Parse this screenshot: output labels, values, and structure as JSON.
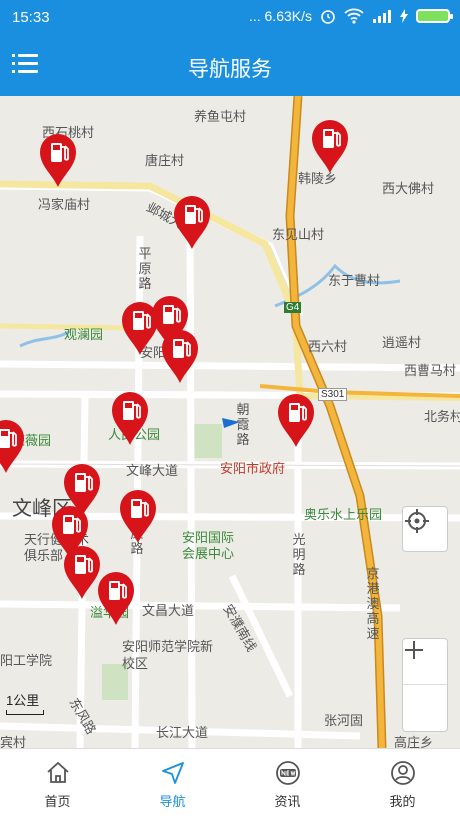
{
  "status": {
    "time": "15:33",
    "speed": "... 6.63K/s"
  },
  "header": {
    "title": "导航服务"
  },
  "map": {
    "labels": [
      {
        "id": "yangyutun",
        "text": "养鱼屯村"
      },
      {
        "id": "xishitaocun",
        "text": "西石桃村"
      },
      {
        "id": "tangzhuangcun",
        "text": "唐庄村"
      },
      {
        "id": "hanlingxiang",
        "text": "韩陵乡"
      },
      {
        "id": "xidafocun",
        "text": "西大佛村"
      },
      {
        "id": "fengjiamiaocun",
        "text": "冯家庙村"
      },
      {
        "id": "yechengdadao",
        "text": "邺城大道"
      },
      {
        "id": "dongjianshancun",
        "text": "东见山村"
      },
      {
        "id": "pingyuanlu",
        "text": "平原路"
      },
      {
        "id": "dongyucaocun",
        "text": "东于曹村"
      },
      {
        "id": "guanlanyuan",
        "text": "观澜园"
      },
      {
        "id": "anyangyizhong",
        "text": "安阳一中"
      },
      {
        "id": "xiliucun",
        "text": "西六村"
      },
      {
        "id": "xiaoyaocun",
        "text": "逍遥村"
      },
      {
        "id": "xicaomacun",
        "text": "西曹马村"
      },
      {
        "id": "beiwucun",
        "text": "北务村"
      },
      {
        "id": "rongweiyuan",
        "text": "荣薇园"
      },
      {
        "id": "renmingongyuan",
        "text": "人民公园"
      },
      {
        "id": "chaoxialu",
        "text": "朝霞路"
      },
      {
        "id": "wenfengdadao",
        "text": "文峰大道"
      },
      {
        "id": "anyangshizhengfu",
        "text": "安阳市政府"
      },
      {
        "id": "wenfengqu",
        "text": "文峰区"
      },
      {
        "id": "aoleshuishang",
        "text": "奥乐水上乐园"
      },
      {
        "id": "tianxingjian",
        "text": "天行健艺术俱乐部"
      },
      {
        "id": "kanglu",
        "text": "康路"
      },
      {
        "id": "huizhanzhongxin",
        "text": "安阳国际会展中心"
      },
      {
        "id": "guangminglu",
        "text": "光明路"
      },
      {
        "id": "jinggangao",
        "text": "京港澳高速"
      },
      {
        "id": "yihuayuan",
        "text": "溢华园"
      },
      {
        "id": "wenchangdadao",
        "text": "文昌大道"
      },
      {
        "id": "anhuanghuanxian",
        "text": "安濮南线"
      },
      {
        "id": "gongxueyuan",
        "text": "阳工学院"
      },
      {
        "id": "shifanxueyuan",
        "text": "安阳师范学院新校区"
      },
      {
        "id": "dongfenglu",
        "text": "东风路"
      },
      {
        "id": "changjiangdadao",
        "text": "长江大道"
      },
      {
        "id": "zhanghegu",
        "text": "张河固"
      },
      {
        "id": "jiacun",
        "text": "宾村"
      },
      {
        "id": "gaozhuangxiang",
        "text": "高庄乡"
      },
      {
        "id": "g4",
        "text": "G4"
      },
      {
        "id": "s301",
        "text": "S301"
      }
    ],
    "scale": "1公里"
  },
  "tabs": [
    {
      "label": "首页",
      "icon": "home-icon"
    },
    {
      "label": "导航",
      "icon": "navigation-icon"
    },
    {
      "label": "资讯",
      "icon": "news-icon"
    },
    {
      "label": "我的",
      "icon": "user-icon"
    }
  ],
  "colors": {
    "accent": "#1a8fe0",
    "pin": "#d8141b",
    "highway": "#f3b53b"
  }
}
